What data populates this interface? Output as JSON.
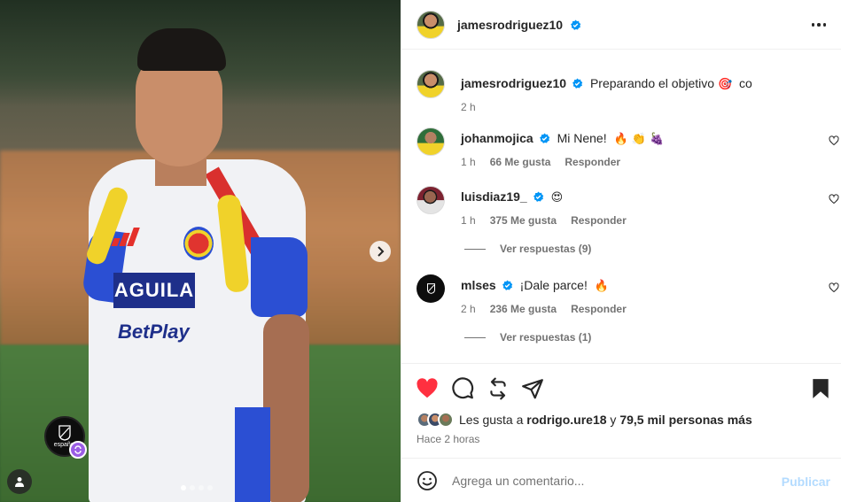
{
  "post": {
    "author": "jamesrodriguez10",
    "caption_text": "Preparando el objetivo",
    "caption_emoji": "🎯",
    "caption_suffix": "co",
    "caption_time": "2 h",
    "jersey_sponsor_1": "AGUILA",
    "jersey_sponsor_2": "BetPlay",
    "collab_badge_label": "español",
    "carousel_dots": 4
  },
  "comments": [
    {
      "username": "johanmojica",
      "text": "Mi Nene!",
      "emojis": "🔥 👏 🍇",
      "time": "1 h",
      "likes": "66 Me gusta",
      "reply": "Responder"
    },
    {
      "username": "luisdiaz19_",
      "text": "",
      "emojis": "😍",
      "time": "1 h",
      "likes": "375 Me gusta",
      "reply": "Responder",
      "view_replies": "Ver respuestas (9)"
    },
    {
      "username": "mlses",
      "text": "¡Dale parce!",
      "emojis": "🔥",
      "time": "2 h",
      "likes": "236 Me gusta",
      "reply": "Responder",
      "view_replies": "Ver respuestas (1)"
    }
  ],
  "likes": {
    "prefix": "Les gusta a",
    "user": "rodrigo.ure18",
    "middle": "y",
    "others": "79,5 mil personas más"
  },
  "time_ago": "Hace 2 horas",
  "composer": {
    "placeholder": "Agrega un comentario...",
    "publish_label": "Publicar"
  },
  "colors": {
    "liked_heart": "#ff3040",
    "verified": "#0095f6",
    "publish_disabled": "#b3dbff"
  }
}
